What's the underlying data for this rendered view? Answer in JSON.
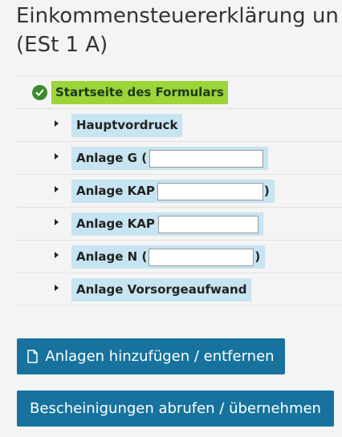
{
  "header": {
    "title_line1": "Einkommensteuererklärung un",
    "title_line2": "(ESt 1 A)"
  },
  "nav": {
    "start_item": {
      "label": "Startseite des Formulars",
      "icon": "check-circle-icon",
      "state": "active"
    },
    "items": [
      {
        "label_prefix": "Hauptvordruck",
        "label_suffix": ""
      },
      {
        "label_prefix": "Anlage G (",
        "label_suffix": ""
      },
      {
        "label_prefix": "Anlage KAP",
        "label_suffix": ")"
      },
      {
        "label_prefix": "Anlage KAP",
        "label_suffix": ""
      },
      {
        "label_prefix": "Anlage N (",
        "label_suffix": ")"
      },
      {
        "label_prefix": "Anlage Vorsorgeaufwand",
        "label_suffix": ""
      }
    ]
  },
  "actions": {
    "add_attachments_label": "Anlagen hinzufügen / entfernen",
    "add_attachments_icon": "document-icon",
    "certificates_label": "Bescheinigungen abrufen / übernehmen"
  },
  "colors": {
    "active_highlight": "#9cd43a",
    "item_highlight": "#c7e4f1",
    "button": "#17739e",
    "check": "#3c8a2e"
  }
}
